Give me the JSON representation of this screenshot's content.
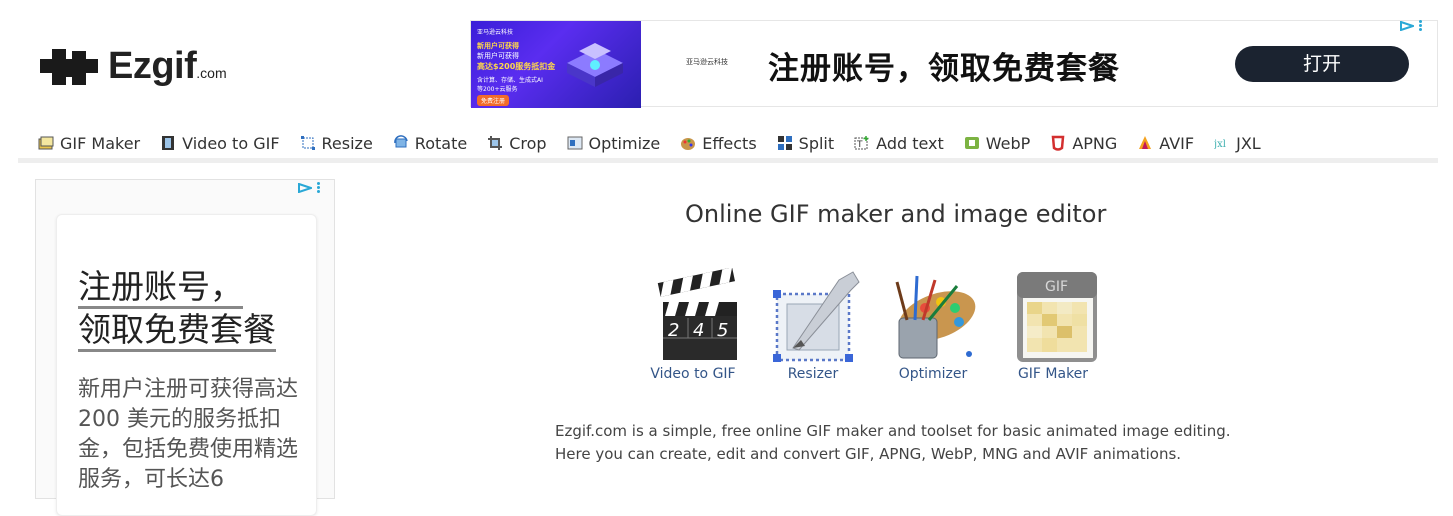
{
  "logo": {
    "name": "Ezgif",
    "tld": ".com"
  },
  "top_ad": {
    "thumb_lines": [
      "亚马逊云科技",
      "新用户可获得",
      "新用户可获得",
      "高达$200服务抵扣金",
      "含计算、存储、生成式AI",
      "等200+云服务",
      "免费注册"
    ],
    "brand_small": "亚马逊云科技",
    "headline": "注册账号，领取免费套餐",
    "button": "打开"
  },
  "nav": {
    "items": [
      {
        "label": "GIF Maker",
        "icon": "gif-maker-icon"
      },
      {
        "label": "Video to GIF",
        "icon": "film-icon"
      },
      {
        "label": "Resize",
        "icon": "resize-icon"
      },
      {
        "label": "Rotate",
        "icon": "rotate-icon"
      },
      {
        "label": "Crop",
        "icon": "crop-icon"
      },
      {
        "label": "Optimize",
        "icon": "optimize-icon"
      },
      {
        "label": "Effects",
        "icon": "palette-icon"
      },
      {
        "label": "Split",
        "icon": "split-icon"
      },
      {
        "label": "Add text",
        "icon": "add-text-icon"
      },
      {
        "label": "WebP",
        "icon": "webp-icon"
      },
      {
        "label": "APNG",
        "icon": "apng-icon"
      },
      {
        "label": "AVIF",
        "icon": "avif-icon"
      },
      {
        "label": "JXL",
        "icon": "jxl-icon"
      }
    ]
  },
  "side_ad": {
    "title_line1": "注册账号，",
    "title_line2": "领取免费套餐",
    "body": "新用户注册可获得高达 200 美元的服务抵扣金，包括免费使用精选服务，可长达6"
  },
  "main": {
    "title": "Online GIF maker and image editor",
    "tools": [
      {
        "label": "Video to GIF",
        "icon": "clapperboard-icon",
        "clapper_text": "2 4 5"
      },
      {
        "label": "Resizer",
        "icon": "resizer-icon"
      },
      {
        "label": "Optimizer",
        "icon": "paint-brushes-icon"
      },
      {
        "label": "GIF Maker",
        "icon": "gif-file-icon",
        "file_text": "GIF"
      }
    ],
    "description_line1": "Ezgif.com is a simple, free online GIF maker and toolset for basic animated image editing.",
    "description_line2": "Here you can create, edit and convert GIF, APNG, WebP, MNG and AVIF animations."
  },
  "colors": {
    "link": "#335588",
    "ad_button": "#1b2330",
    "adchoice": "#2aa8d6"
  }
}
